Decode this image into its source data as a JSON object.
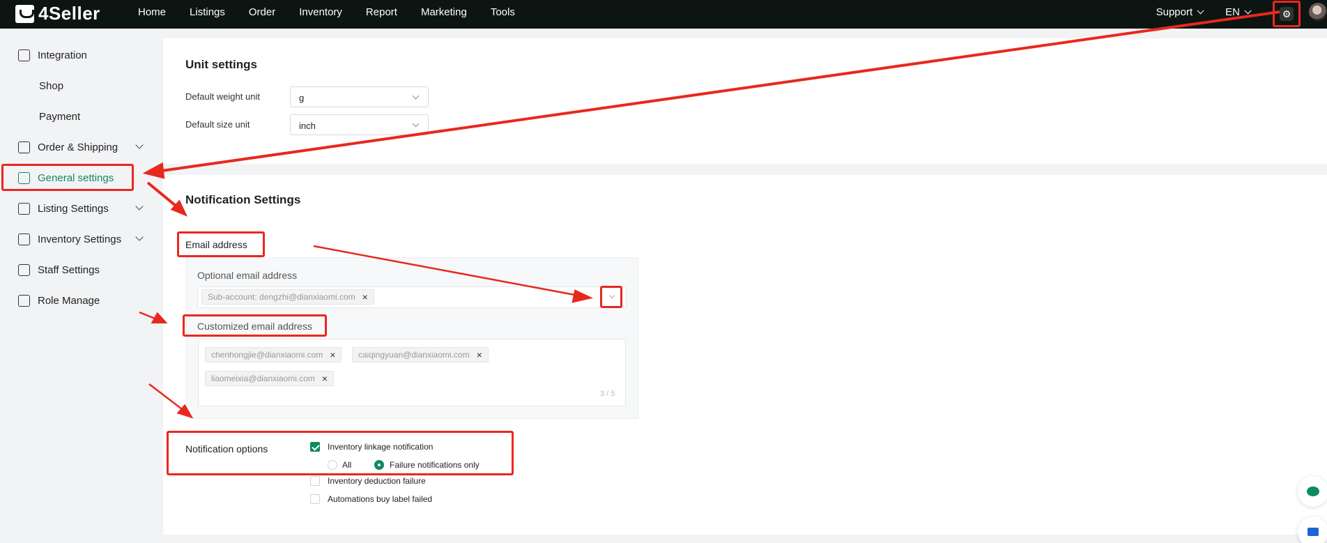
{
  "brand": {
    "name": "4Seller"
  },
  "nav": {
    "items": [
      "Home",
      "Listings",
      "Order",
      "Inventory",
      "Report",
      "Marketing",
      "Tools"
    ],
    "support": "Support",
    "language": "EN"
  },
  "sidebar": {
    "items": [
      {
        "label": "Integration",
        "icon": "integration-icon"
      },
      {
        "label": "Shop"
      },
      {
        "label": "Payment"
      },
      {
        "label": "Order & Shipping",
        "icon": "order-icon"
      },
      {
        "label": "General settings",
        "icon": "general-icon",
        "active": true
      },
      {
        "label": "Listing Settings",
        "icon": "listing-icon"
      },
      {
        "label": "Inventory Settings",
        "icon": "inventory-icon"
      },
      {
        "label": "Staff Settings",
        "icon": "staff-icon"
      },
      {
        "label": "Role Manage",
        "icon": "role-icon"
      }
    ]
  },
  "unit_settings": {
    "title": "Unit settings",
    "weight_label": "Default weight unit",
    "weight_value": "g",
    "size_label": "Default size unit",
    "size_value": "inch"
  },
  "notification_settings": {
    "title": "Notification Settings",
    "email_label": "Email address",
    "optional_label": "Optional email address",
    "optional_tags": [
      "Sub-account: dengzhi@dianxiaomi.com"
    ],
    "customized_label": "Customized email address",
    "customized_tags": [
      "chenhongjie@dianxiaomi.com",
      "caiqingyuan@dianxiaomi.com",
      "liaomeixia@dianxiaomi.com"
    ],
    "counter": "3 / 5",
    "options_label": "Notification options",
    "options": {
      "inventory_linkage": "Inventory linkage notification",
      "all": "All",
      "failure_only": "Failure notifications only",
      "deduction_failure": "Inventory deduction failure",
      "buy_label_failed": "Automations buy label failed"
    }
  },
  "colors": {
    "accent": "#0f8a5f",
    "highlight": "#e8281e",
    "topbar": "#0c1512"
  }
}
